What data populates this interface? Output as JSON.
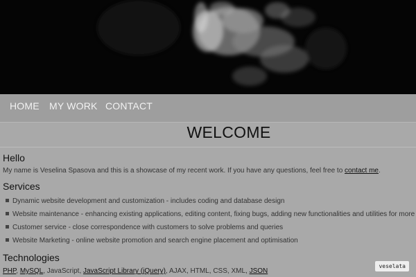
{
  "nav": {
    "items": [
      {
        "label": "HOME"
      },
      {
        "label": "MY WORK"
      },
      {
        "label": "CONTACT"
      }
    ]
  },
  "welcome": {
    "title": "WELCOME"
  },
  "hello": {
    "heading": "Hello",
    "text_before": "My name is Veselina Spasova and this is a showcase of my recent work. If you have any questions, feel free to ",
    "link": "contact me",
    "text_after": "."
  },
  "services": {
    "heading": "Services",
    "items": [
      "Dynamic website development and customization - includes coding and database design",
      "Website maintenance - enhancing existing applications, editing content, fixing bugs, adding new functionalities and utilities for more inter",
      "Customer service - close correspondence with customers to solve problems and queries",
      "Website Marketing - online website promotion and search engine placement and optimisation"
    ]
  },
  "technologies": {
    "heading": "Technologies",
    "items": [
      {
        "label": "PHP",
        "link": true
      },
      {
        "label": "MySQL",
        "link": true
      },
      {
        "label": "JavaScript",
        "link": false
      },
      {
        "label": "JavaScript Library (jQuery)",
        "link": true
      },
      {
        "label": "AJAX",
        "link": false
      },
      {
        "label": "HTML",
        "link": false
      },
      {
        "label": "CSS",
        "link": false
      },
      {
        "label": "XML",
        "link": false
      },
      {
        "label": "JSON",
        "link": true
      }
    ]
  },
  "badge": {
    "label": "veselata"
  }
}
